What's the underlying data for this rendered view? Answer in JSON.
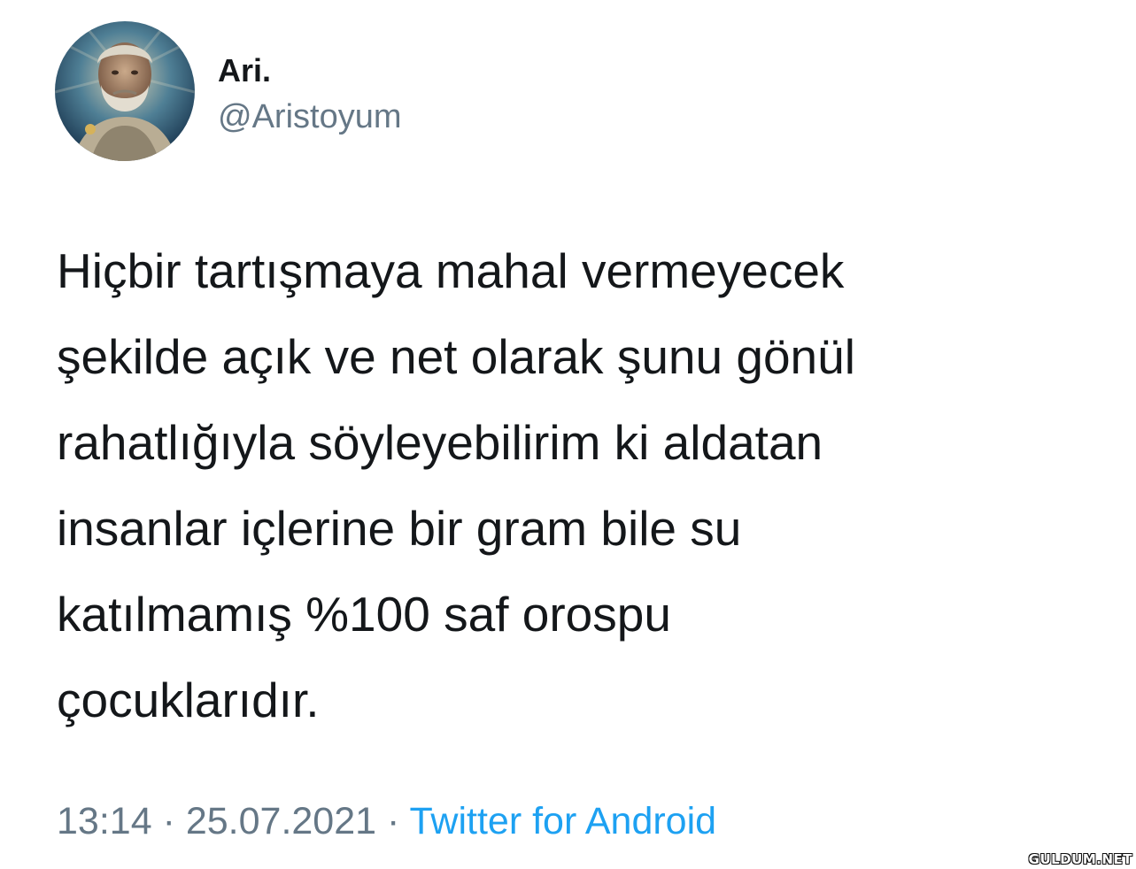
{
  "user": {
    "display_name": "Ari.",
    "handle": "@Aristoyum",
    "avatar_icon": "bearded-man-portrait-avatar"
  },
  "tweet": {
    "lines": [
      "Hiçbir tartışmaya mahal vermeyecek",
      "şekilde açık ve net olarak şunu gönül",
      "rahatlığıyla söyleyebilirim ki aldatan",
      "insanlar içlerine bir gram bile su",
      "katılmamış %100 saf orospu",
      "çocuklarıdır."
    ],
    "time": "13:14",
    "separator": "·",
    "date": "25.07.2021",
    "source": "Twitter for Android"
  },
  "watermark": {
    "text": "GULDUM.NET"
  },
  "colors": {
    "text": "#14171a",
    "secondary": "#657786",
    "link": "#1da1f2"
  }
}
